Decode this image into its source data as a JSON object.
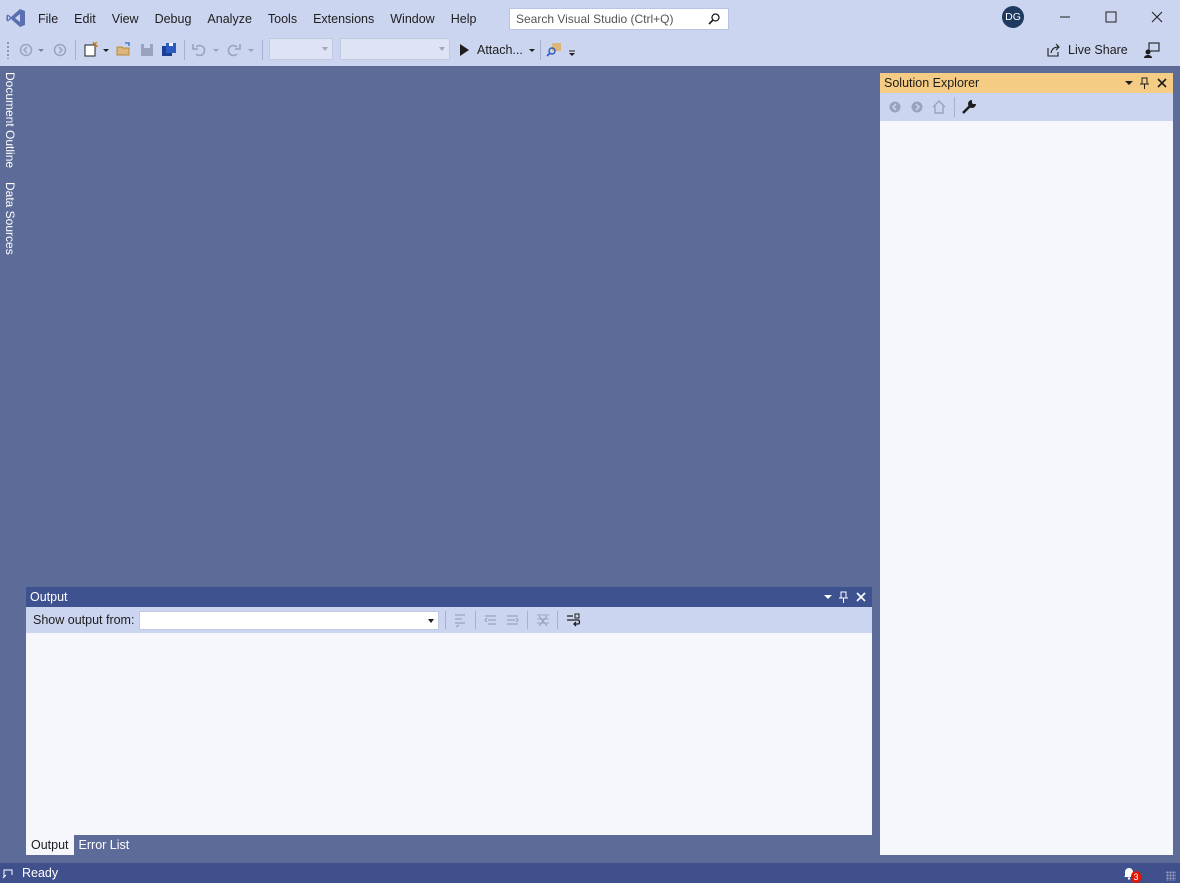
{
  "menu": [
    "File",
    "Edit",
    "View",
    "Debug",
    "Analyze",
    "Tools",
    "Extensions",
    "Window",
    "Help"
  ],
  "search": {
    "placeholder": "Search Visual Studio (Ctrl+Q)"
  },
  "user": {
    "initials": "DG"
  },
  "toolbar": {
    "attach_label": "Attach...",
    "live_share_label": "Live Share"
  },
  "side_tabs": [
    "Document Outline",
    "Data Sources"
  ],
  "solution_explorer": {
    "title": "Solution Explorer"
  },
  "output": {
    "title": "Output",
    "show_from_label": "Show output from:",
    "show_from_value": ""
  },
  "bottom_tabs": [
    "Output",
    "Error List"
  ],
  "status": {
    "text": "Ready",
    "notifications": "3"
  },
  "colors": {
    "chrome": "#ccd5f0",
    "background": "#5d6b99",
    "active_tool_header": "#f5cc84",
    "output_header": "#3f5290",
    "status_bar": "#40508d"
  }
}
